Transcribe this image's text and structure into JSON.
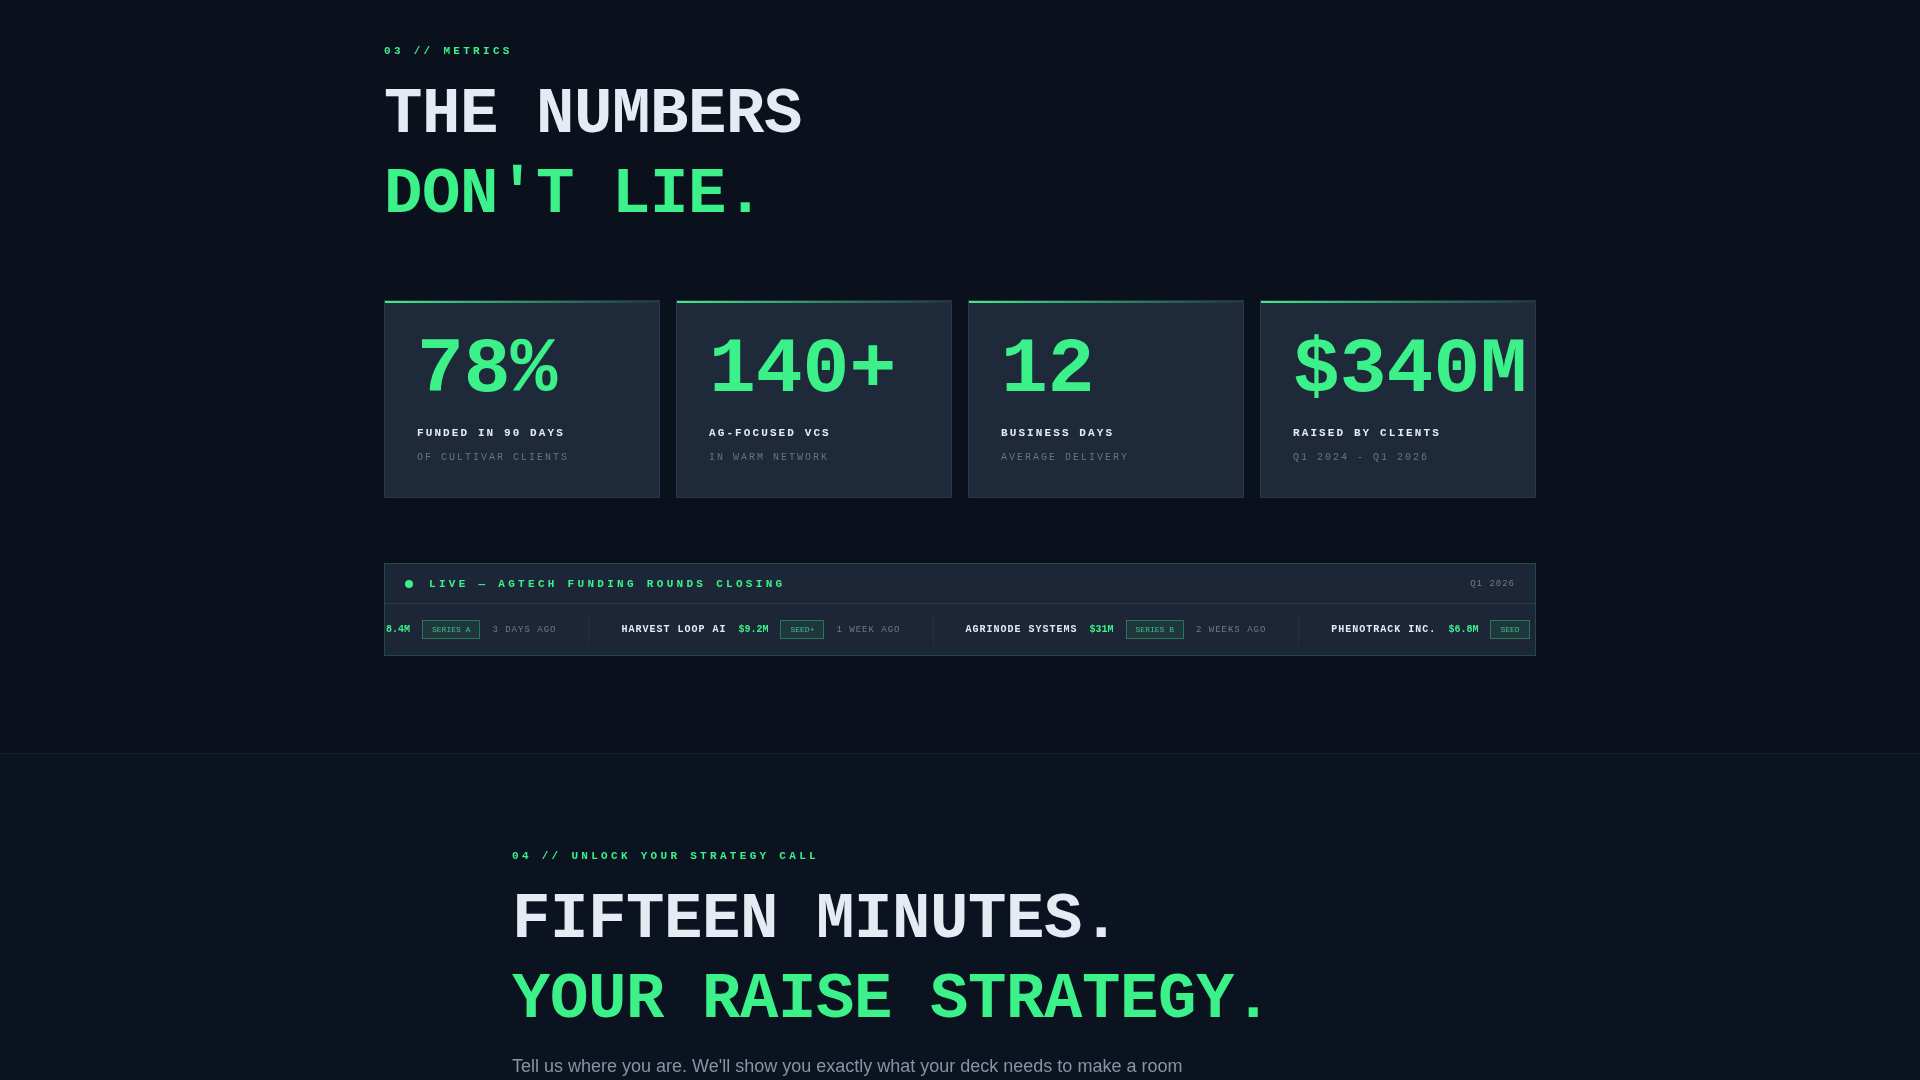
{
  "metrics": {
    "section_label": "03 // METRICS",
    "heading": "THE NUMBERS",
    "heading_accent": "DON'T LIE.",
    "stats": [
      {
        "value": "78%",
        "label": "FUNDED IN 90 DAYS",
        "caption": "OF CULTIVAR CLIENTS"
      },
      {
        "value": "140+",
        "label": "AG-FOCUSED VCS",
        "caption": "IN WARM NETWORK"
      },
      {
        "value": "12",
        "label": "BUSINESS DAYS",
        "caption": "AVERAGE DELIVERY"
      },
      {
        "value": "$340M",
        "label": "RAISED BY CLIENTS",
        "caption": "Q1 2024 - Q1 2026"
      }
    ],
    "ticker": {
      "title": "LIVE — AGTECH FUNDING ROUNDS CLOSING",
      "period": "Q1 2026",
      "rounds": [
        {
          "amount": "8.4M",
          "stage": "SERIES A",
          "time": "3 DAYS AGO"
        },
        {
          "company": "HARVEST LOOP AI",
          "amount": "$9.2M",
          "stage": "SEED+",
          "time": "1 WEEK AGO"
        },
        {
          "company": "AGRINODE SYSTEMS",
          "amount": "$31M",
          "stage": "SERIES B",
          "time": "2 WEEKS AGO"
        },
        {
          "company": "PHENOTRACK INC.",
          "amount": "$6.8M",
          "stage": "SEED"
        }
      ]
    }
  },
  "strategy_call": {
    "section_label": "04 // UNLOCK YOUR STRATEGY CALL",
    "heading": "FIFTEEN MINUTES.",
    "heading_accent": "YOUR RAISE STRATEGY.",
    "intro": "Tell us where you are. We'll show you exactly what your deck needs to make a room"
  }
}
